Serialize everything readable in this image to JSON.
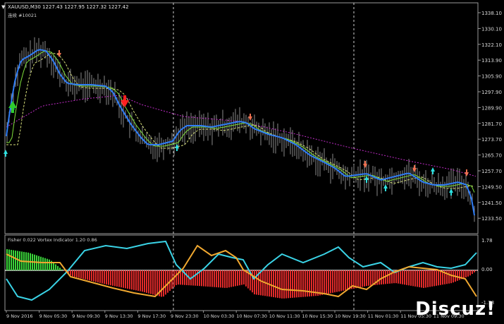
{
  "header": {
    "symbol_line": "XAUUSD,M30  1227.43 1227.95 1227.32 1227.42",
    "sub_line": "连续    #10021"
  },
  "indicator_header": "Fisher 0.022  Vortex Indicator 1.20 0.86",
  "price_axis": [
    "1338.10",
    "1330.10",
    "1322.10",
    "1313.90",
    "1305.90",
    "1297.90",
    "1289.90",
    "1281.70",
    "1273.70",
    "1265.70",
    "1257.70",
    "1249.50",
    "1241.50",
    "1233.50"
  ],
  "indicator_axis": [
    "1.78",
    "0.00",
    "-1.78"
  ],
  "time_axis": [
    "9 Nov 2016",
    "9 Nov 05:30",
    "9 Nov 09:30",
    "9 Nov 13:30",
    "9 Nov 17:30",
    "9 Nov 23:30",
    "10 Nov 03:30",
    "10 Nov 07:30",
    "10 Nov 11:30",
    "10 Nov 15:30",
    "10 Nov 19:30",
    "11 Nov 01:30",
    "11 Nov 05:30",
    "11 Nov 09:30"
  ],
  "watermark": "Discuz!",
  "colors": {
    "background": "#000000",
    "fast_ma": "#2f7df6",
    "mid_ma": "#7fe03a",
    "slow_ma": "#d7e07a",
    "long_ma": "#c02cc7",
    "bull_hist": "#3ad43a",
    "bear_hist": "#e02a2a",
    "vortex_plus": "#3ad3e6",
    "vortex_minus": "#f0a830",
    "arrow_up": "#2ee0e0",
    "arrow_down": "#f07050"
  }
}
